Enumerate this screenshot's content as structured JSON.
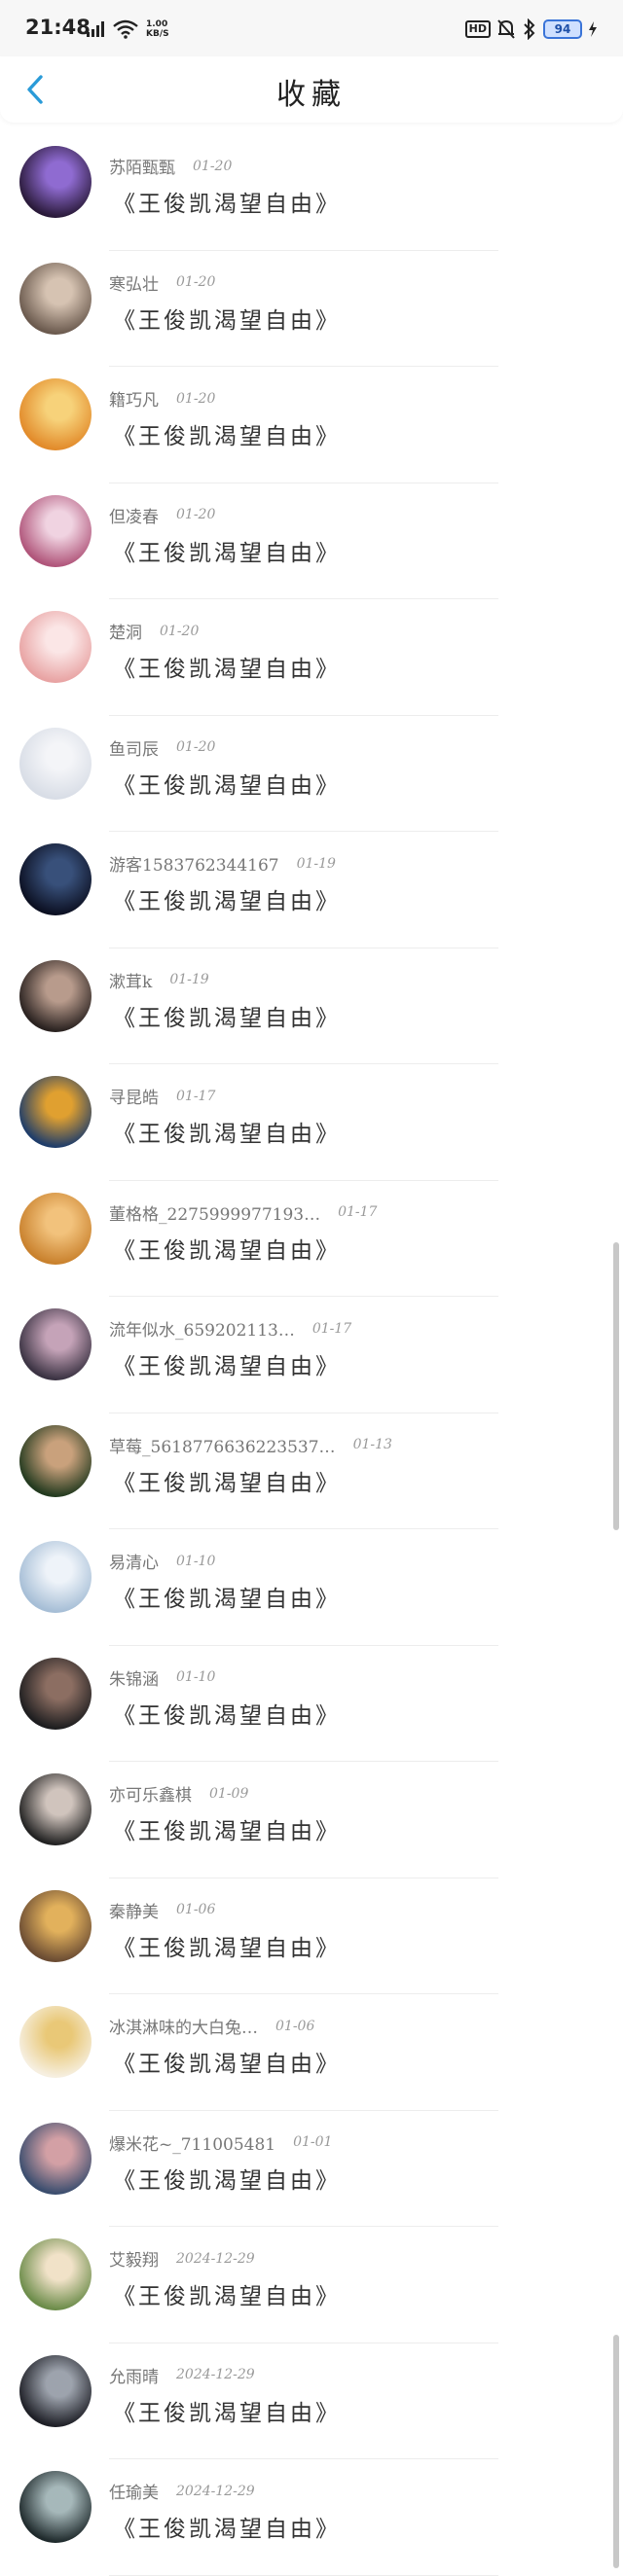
{
  "status_bar": {
    "time": "21:48",
    "network_speed_value": "1.00",
    "network_speed_unit": "KB/S",
    "hd_label": "HD",
    "battery": "94"
  },
  "header": {
    "title": "收藏",
    "back_icon": "chevron-left-icon"
  },
  "favorites": [
    {
      "user": "苏陌甄甄",
      "date": "01-20",
      "title": "《王俊凯渴望自由》",
      "avatar_colors": [
        "#2a1a3a",
        "#8f6bd1"
      ]
    },
    {
      "user": "寒弘壮",
      "date": "01-20",
      "title": "《王俊凯渴望自由》",
      "avatar_colors": [
        "#6b5a4e",
        "#d6c3b2"
      ]
    },
    {
      "user": "籍巧凡",
      "date": "01-20",
      "title": "《王俊凯渴望自由》",
      "avatar_colors": [
        "#e28b2b",
        "#f7d27a"
      ]
    },
    {
      "user": "但凌春",
      "date": "01-20",
      "title": "《王俊凯渴望自由》",
      "avatar_colors": [
        "#b0557a",
        "#f0d3e1"
      ]
    },
    {
      "user": "楚洞",
      "date": "01-20",
      "title": "《王俊凯渴望自由》",
      "avatar_colors": [
        "#e8a3a3",
        "#fbe6e6"
      ]
    },
    {
      "user": "鱼司辰",
      "date": "01-20",
      "title": "《王俊凯渴望自由》",
      "avatar_colors": [
        "#d8dde6",
        "#f4f5f8"
      ]
    },
    {
      "user": "游客1583762344167",
      "date": "01-19",
      "title": "《王俊凯渴望自由》",
      "avatar_colors": [
        "#0c1022",
        "#38507a"
      ]
    },
    {
      "user": "漱茸k",
      "date": "01-19",
      "title": "《王俊凯渴望自由》",
      "avatar_colors": [
        "#2a2220",
        "#b89b8c"
      ]
    },
    {
      "user": "寻昆皓",
      "date": "01-17",
      "title": "《王俊凯渴望自由》",
      "avatar_colors": [
        "#1f3d6a",
        "#e0a030"
      ]
    },
    {
      "user": "董格格_2275999977193…",
      "date": "01-17",
      "title": "《王俊凯渴望自由》",
      "avatar_colors": [
        "#c9812d",
        "#f2c27c"
      ]
    },
    {
      "user": "流年似水_659202113…",
      "date": "01-17",
      "title": "《王俊凯渴望自由》",
      "avatar_colors": [
        "#3b3343",
        "#c5a3b8"
      ]
    },
    {
      "user": "草莓_5618776636223537…",
      "date": "01-13",
      "title": "《王俊凯渴望自由》",
      "avatar_colors": [
        "#233a1f",
        "#c9a17c"
      ]
    },
    {
      "user": "易清心",
      "date": "01-10",
      "title": "《王俊凯渴望自由》",
      "avatar_colors": [
        "#a6bed6",
        "#eef3f9"
      ]
    },
    {
      "user": "朱锦涵",
      "date": "01-10",
      "title": "《王俊凯渴望自由》",
      "avatar_colors": [
        "#1d1d1f",
        "#8c6e62"
      ]
    },
    {
      "user": "亦可乐鑫棋",
      "date": "01-09",
      "title": "《王俊凯渴望自由》",
      "avatar_colors": [
        "#222222",
        "#d0c4bd"
      ]
    },
    {
      "user": "秦静美",
      "date": "01-06",
      "title": "《王俊凯渴望自由》",
      "avatar_colors": [
        "#6b4c33",
        "#e2b15c"
      ]
    },
    {
      "user": "冰淇淋味的大白兔…",
      "date": "01-06",
      "title": "《王俊凯渴望自由》",
      "avatar_colors": [
        "#f6efe0",
        "#e9c877"
      ]
    },
    {
      "user": "爆米花~_711005481",
      "date": "01-01",
      "title": "《王俊凯渴望自由》",
      "avatar_colors": [
        "#3a4d6e",
        "#d3a0a5"
      ]
    },
    {
      "user": "艾毅翔",
      "date": "2024-12-29",
      "title": "《王俊凯渴望自由》",
      "avatar_colors": [
        "#6c8c4a",
        "#f1e2c8"
      ]
    },
    {
      "user": "允雨晴",
      "date": "2024-12-29",
      "title": "《王俊凯渴望自由》",
      "avatar_colors": [
        "#1e1f26",
        "#9da3ad"
      ]
    },
    {
      "user": "任瑜美",
      "date": "2024-12-29",
      "title": "《王俊凯渴望自由》",
      "avatar_colors": [
        "#1f2a2c",
        "#a6b8ba"
      ]
    }
  ]
}
